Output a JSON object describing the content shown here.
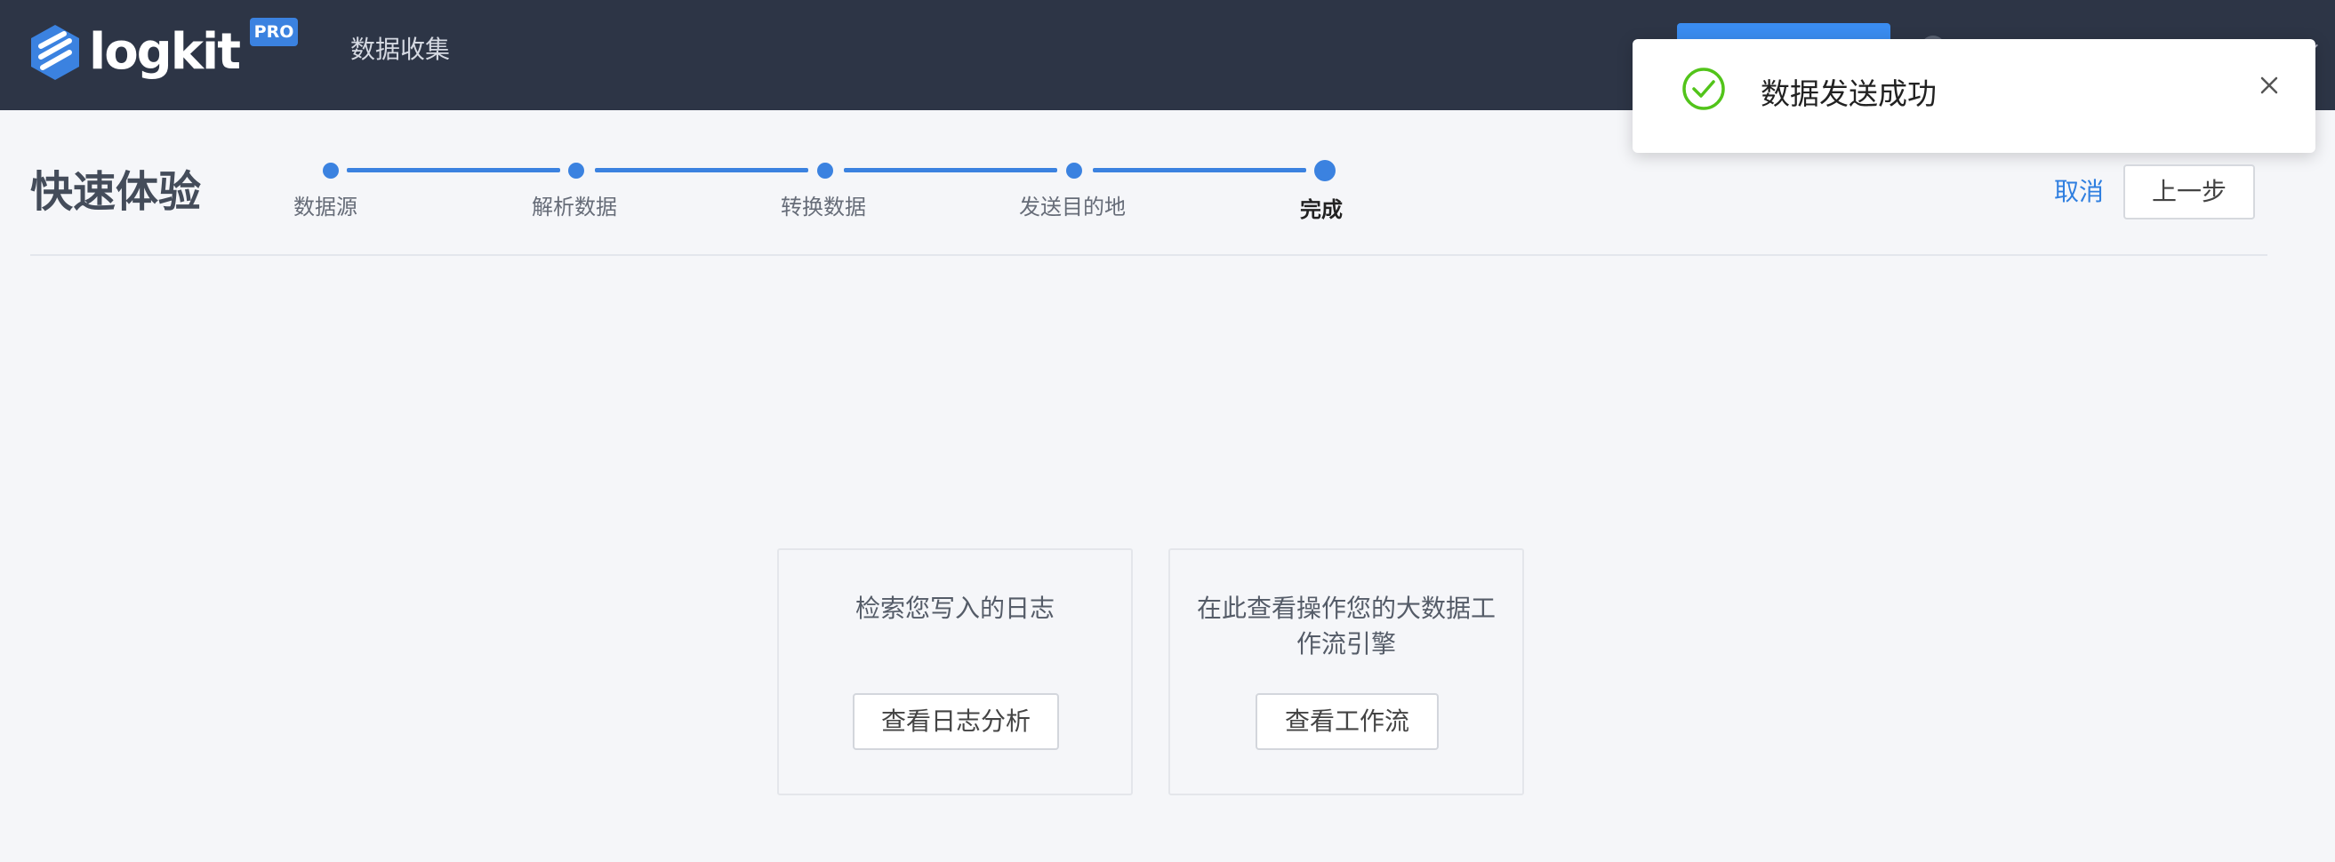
{
  "header": {
    "brand": "logkit",
    "badge": "PRO",
    "nav": [
      "数据收集"
    ],
    "colors": {
      "bar": "#2d3546",
      "accent": "#3b82e0"
    }
  },
  "toast": {
    "message": "数据发送成功",
    "icon": "check-circle-icon",
    "close_icon": "close-icon",
    "status_color": "#52c41a"
  },
  "page": {
    "title": "快速体验",
    "cancel_label": "取消",
    "prev_label": "上一步"
  },
  "steps": {
    "items": [
      "数据源",
      "解析数据",
      "转换数据",
      "发送目的地",
      "完成"
    ],
    "current": 4
  },
  "cards": [
    {
      "description": "检索您写入的日志",
      "button": "查看日志分析"
    },
    {
      "description": "在此查看操作您的大数据工作流引擎",
      "button": "查看工作流"
    }
  ]
}
